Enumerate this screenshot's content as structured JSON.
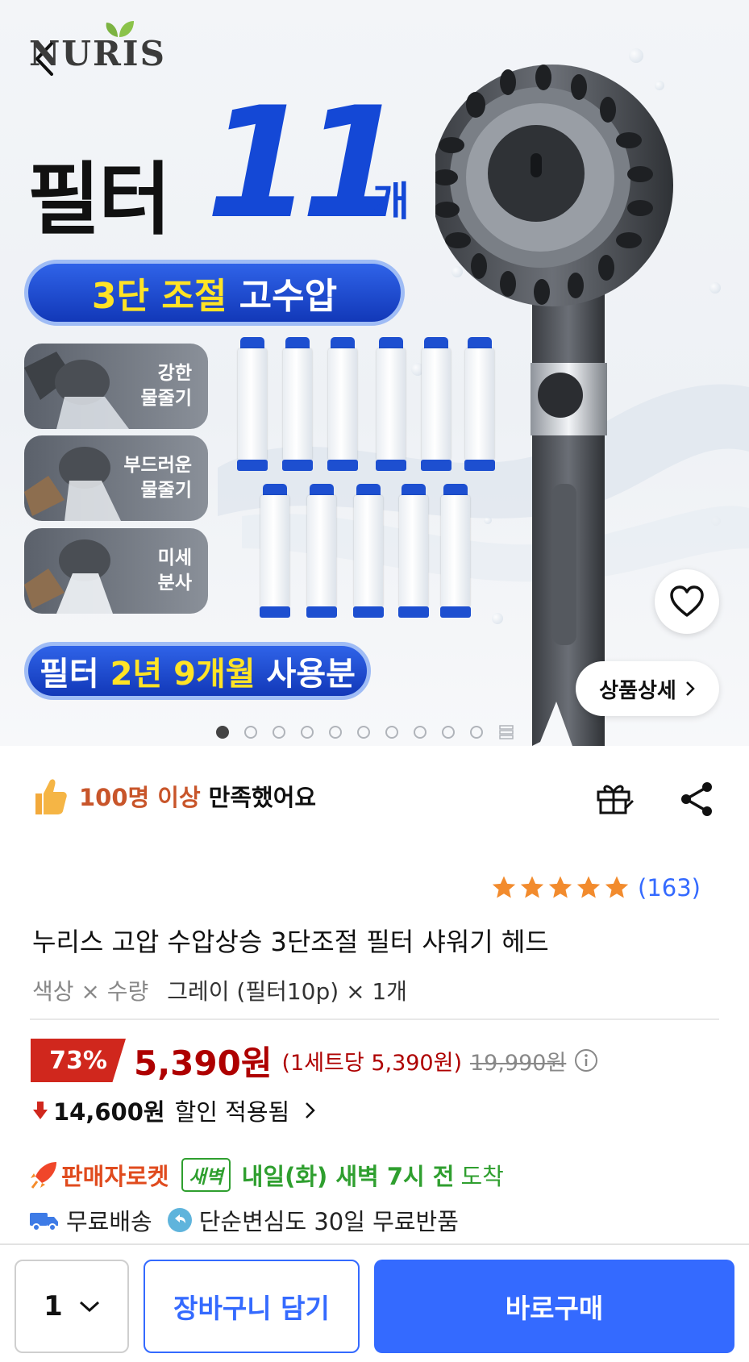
{
  "hero": {
    "logo": "NURIS",
    "headline_a": "필터",
    "headline_b": "11",
    "headline_c": "개",
    "pill1": {
      "highlight": "3단 조절",
      "rest": "고수압"
    },
    "modes": [
      {
        "label": "강한\n물줄기"
      },
      {
        "label": "부드러운\n물줄기"
      },
      {
        "label": "미세\n분사"
      }
    ],
    "pill2": {
      "part1": "필터",
      "highlight": "2년 9개월",
      "part2": "사용분"
    },
    "detail_button": "상품상세",
    "slide_count": 10,
    "active_slide": 0
  },
  "satisfaction": {
    "highlight": "100명 이상",
    "rest": "만족했어요"
  },
  "rating": {
    "stars": 5,
    "count": "(163)"
  },
  "product": {
    "title": "누리스 고압 수압상승 3단조절 필터 샤워기 헤드",
    "option_label": "색상 × 수량",
    "option_value": "그레이 (필터10p) × 1개"
  },
  "price": {
    "discount": "73%",
    "sale": "5,390원",
    "unit": "(1세트당 5,390원)",
    "original": "19,990원",
    "discount_amount": "14,600원",
    "discount_text": "할인 적용됨"
  },
  "delivery": {
    "seller": "판매자로켓",
    "dawn_badge": "새벽",
    "eta": "내일(화) 새벽 7시 전",
    "arrive": "도착",
    "free_shipping": "무료배송",
    "return": "단순변심도 30일 무료반품"
  },
  "bottom": {
    "qty": "1",
    "cart": "장바구니 담기",
    "buy": "바로구매"
  },
  "colors": {
    "accent": "#346aff",
    "price": "#ae0000",
    "badge": "#d0271d",
    "green": "#2f9f2f",
    "hero_blue": "#1448d6"
  }
}
